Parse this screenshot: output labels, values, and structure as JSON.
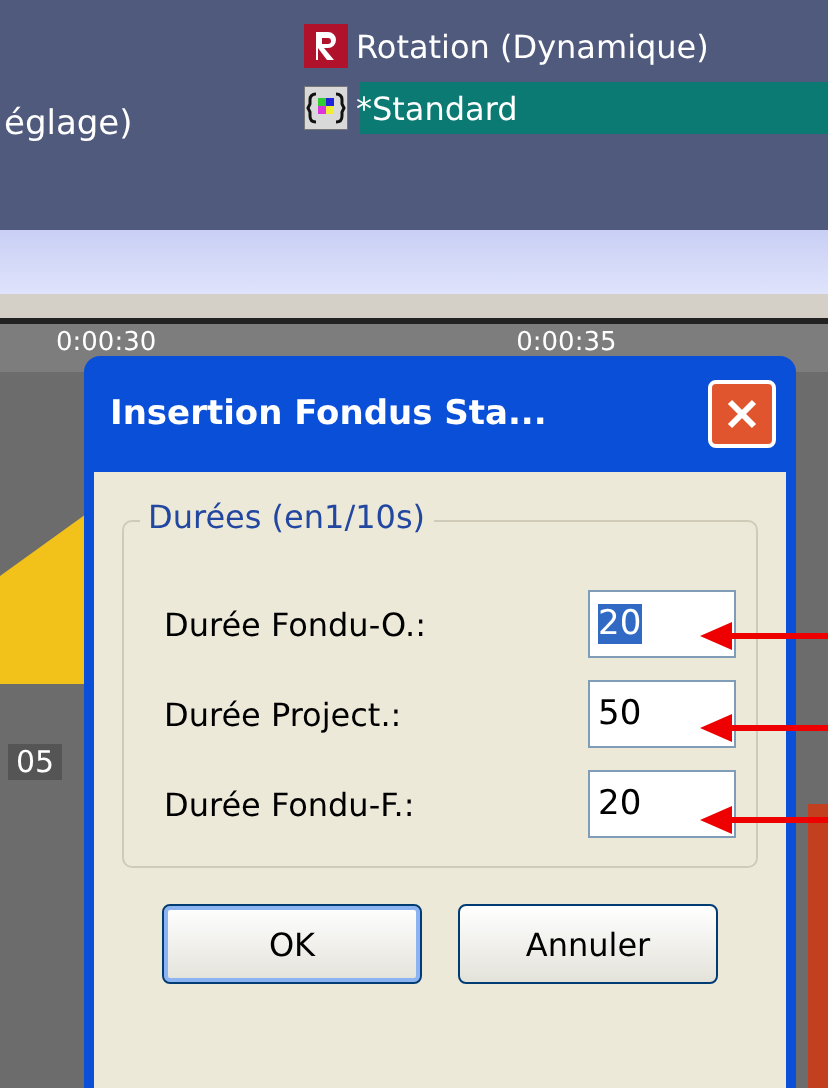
{
  "top_panel": {
    "left_label": "églage)",
    "items": [
      {
        "kind": "rotation",
        "label": "Rotation (Dynamique)",
        "selected": false
      },
      {
        "kind": "palette",
        "label": "*Standard",
        "selected": true
      }
    ]
  },
  "timeline": {
    "ticks": [
      "0:00:30",
      "0:00:35"
    ],
    "row_label": "05"
  },
  "dialog": {
    "title": "Insertion Fondus Sta...",
    "group_label": "Durées (en1/10s)",
    "fields": [
      {
        "label": "Durée Fondu-O.:",
        "value": "20",
        "selected": true
      },
      {
        "label": "Durée Project.:",
        "value": "50",
        "selected": false
      },
      {
        "label": "Durée Fondu-F.:",
        "value": "20",
        "selected": false
      }
    ],
    "buttons": [
      {
        "label": "OK",
        "default": true
      },
      {
        "label": "Annuler",
        "default": false
      }
    ]
  }
}
